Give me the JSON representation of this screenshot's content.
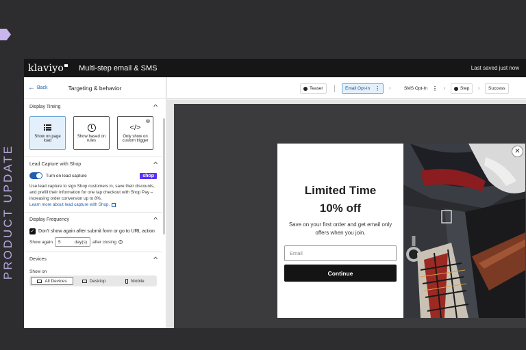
{
  "side_label": "PRODUCT UPDATE",
  "topbar": {
    "logo": "klaviyo",
    "title": "Multi-step email & SMS",
    "saved": "Last saved just now"
  },
  "left_panel": {
    "back": "Back",
    "title": "Targeting & behavior",
    "display_timing": {
      "heading": "Display Timing",
      "tiles": [
        {
          "label": "Show on page load",
          "icon": "list-icon",
          "selected": true
        },
        {
          "label": "Show based on rules",
          "icon": "clock-icon",
          "selected": false
        },
        {
          "label": "Only show on custom trigger",
          "icon": "code-icon",
          "selected": false
        }
      ]
    },
    "lead_capture": {
      "heading": "Lead Capture with Shop",
      "toggle_label": "Turn on lead capture",
      "toggle_on": true,
      "badge": "shop",
      "description": "Use lead capture to sign Shop customers in, save their discounts, and prefill their information for one tap checkout with Shop Pay – increasing order conversion up to 8%.",
      "link": "Learn more about lead capture with Shop."
    },
    "frequency": {
      "heading": "Display Frequency",
      "checkbox_label": "Don't show again after submit form or go to URL action",
      "checked": true,
      "show_again_label": "Show again",
      "show_again_value": "5",
      "unit": "day(s)",
      "after_label": "after closing"
    },
    "devices": {
      "heading": "Devices",
      "show_on_label": "Show on",
      "options": [
        "All Devices",
        "Desktop",
        "Mobile"
      ],
      "selected": "All Devices"
    }
  },
  "steps": {
    "items": [
      "Teaser",
      "Email Opt-In",
      "SMS Opt-In",
      "Step",
      "Success"
    ],
    "active": "Email Opt-In"
  },
  "popup": {
    "headline_1": "Limited Time",
    "headline_2": "10% off",
    "body": "Save on your first order and get email only offers when you join.",
    "email_placeholder": "Email",
    "button": "Continue",
    "close": "✕"
  },
  "colors": {
    "brand_blue": "#1f5fae",
    "shop_purple": "#5a31f4",
    "accent_lavender": "#c9b6ec"
  }
}
